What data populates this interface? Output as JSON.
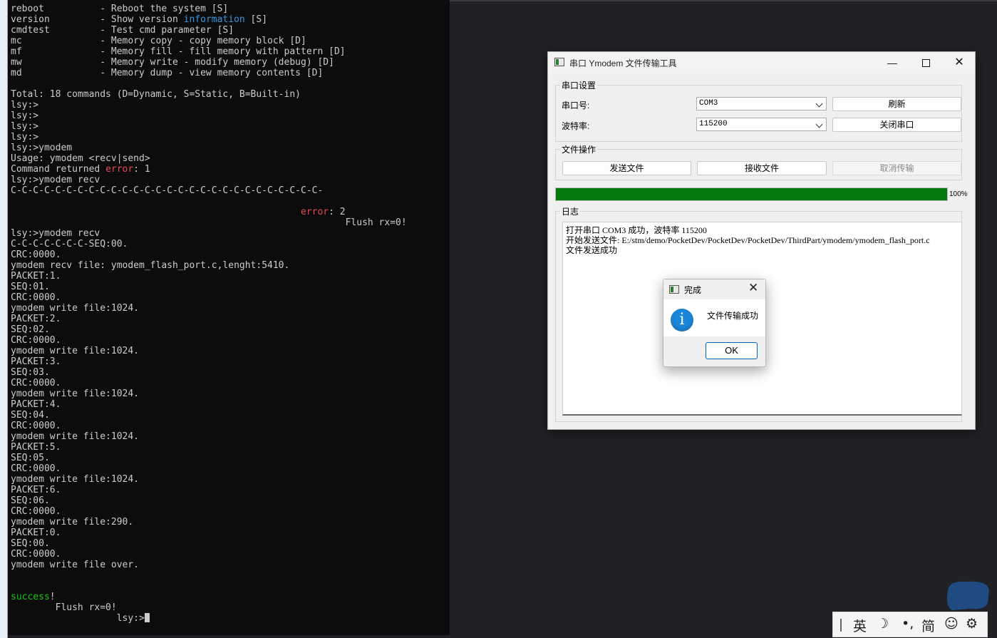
{
  "terminal": {
    "lines": [
      [
        {
          "t": "reboot          - Reboot the system [S]"
        }
      ],
      [
        {
          "t": "version         - Show version "
        },
        {
          "t": "information",
          "c": "t-blue"
        },
        {
          "t": " [S]"
        }
      ],
      [
        {
          "t": "cmdtest         - Test cmd parameter [S]"
        }
      ],
      [
        {
          "t": "mc              - Memory copy - copy memory block [D]"
        }
      ],
      [
        {
          "t": "mf              - Memory fill - fill memory with pattern [D]"
        }
      ],
      [
        {
          "t": "mw              - Memory write - modify memory (debug) [D]"
        }
      ],
      [
        {
          "t": "md              - Memory dump - view memory contents [D]"
        }
      ],
      [
        {
          "t": ""
        }
      ],
      [
        {
          "t": "Total: 18 commands (D=Dynamic, S=Static, B=Built-in)"
        }
      ],
      [
        {
          "t": "lsy:>"
        }
      ],
      [
        {
          "t": "lsy:>"
        }
      ],
      [
        {
          "t": "lsy:>"
        }
      ],
      [
        {
          "t": "lsy:>"
        }
      ],
      [
        {
          "t": "lsy:>ymodem"
        }
      ],
      [
        {
          "t": "Usage: ymodem <recv|send>"
        }
      ],
      [
        {
          "t": "Command returned "
        },
        {
          "t": "error",
          "c": "t-red"
        },
        {
          "t": ": 1"
        }
      ],
      [
        {
          "t": "lsy:>ymodem recv"
        }
      ],
      [
        {
          "t": "C-C-C-C-C-C-C-C-C-C-C-C-C-C-C-C-C-C-C-C-C-C-C-C-C-C-C-C-"
        }
      ],
      [
        {
          "t": ""
        }
      ],
      [
        {
          "t": "                                                    "
        },
        {
          "t": "error",
          "c": "t-red"
        },
        {
          "t": ": 2"
        }
      ],
      [
        {
          "t": "                                                            Flush rx=0!"
        }
      ],
      [
        {
          "t": "lsy:>ymodem recv"
        }
      ],
      [
        {
          "t": "C-C-C-C-C-C-C-SEQ:00."
        }
      ],
      [
        {
          "t": "CRC:0000."
        }
      ],
      [
        {
          "t": "ymodem recv file: ymodem_flash_port.c,lenght:5410."
        }
      ],
      [
        {
          "t": "PACKET:1."
        }
      ],
      [
        {
          "t": "SEQ:01."
        }
      ],
      [
        {
          "t": "CRC:0000."
        }
      ],
      [
        {
          "t": "ymodem write file:1024."
        }
      ],
      [
        {
          "t": "PACKET:2."
        }
      ],
      [
        {
          "t": "SEQ:02."
        }
      ],
      [
        {
          "t": "CRC:0000."
        }
      ],
      [
        {
          "t": "ymodem write file:1024."
        }
      ],
      [
        {
          "t": "PACKET:3."
        }
      ],
      [
        {
          "t": "SEQ:03."
        }
      ],
      [
        {
          "t": "CRC:0000."
        }
      ],
      [
        {
          "t": "ymodem write file:1024."
        }
      ],
      [
        {
          "t": "PACKET:4."
        }
      ],
      [
        {
          "t": "SEQ:04."
        }
      ],
      [
        {
          "t": "CRC:0000."
        }
      ],
      [
        {
          "t": "ymodem write file:1024."
        }
      ],
      [
        {
          "t": "PACKET:5."
        }
      ],
      [
        {
          "t": "SEQ:05."
        }
      ],
      [
        {
          "t": "CRC:0000."
        }
      ],
      [
        {
          "t": "ymodem write file:1024."
        }
      ],
      [
        {
          "t": "PACKET:6."
        }
      ],
      [
        {
          "t": "SEQ:06."
        }
      ],
      [
        {
          "t": "CRC:0000."
        }
      ],
      [
        {
          "t": "ymodem write file:290."
        }
      ],
      [
        {
          "t": "PACKET:0."
        }
      ],
      [
        {
          "t": "SEQ:00."
        }
      ],
      [
        {
          "t": "CRC:0000."
        }
      ],
      [
        {
          "t": "ymodem write file over."
        }
      ],
      [
        {
          "t": ""
        }
      ],
      [
        {
          "t": ""
        }
      ],
      [
        {
          "t": "success",
          "c": "t-green"
        },
        {
          "t": "!"
        }
      ],
      [
        {
          "t": "        Flush rx=0!"
        }
      ],
      [
        {
          "t": "                   lsy:>"
        },
        {
          "cursor": true
        }
      ]
    ]
  },
  "window": {
    "title": "串口 Ymodem 文件传输工具",
    "icon": "app-window-icon",
    "min_glyph": "—",
    "close_glyph": "✕",
    "serial_group": {
      "title": "串口设置",
      "port_label": "串口号:",
      "port_value": "COM3",
      "baud_label": "波特率:",
      "baud_value": "115200",
      "refresh_label": "刷新",
      "close_port_label": "关闭串口"
    },
    "file_group": {
      "title": "文件操作",
      "send_label": "发送文件",
      "recv_label": "接收文件",
      "cancel_label": "取消传输"
    },
    "progress": {
      "value": 100,
      "text": "100%",
      "color": "#06790e"
    },
    "log_group": {
      "title": "日志",
      "lines": [
        "打开串口 COM3 成功，波特率 115200",
        "开始发送文件: E:/stm/demo/PocketDev/PocketDev/PocketDev/ThirdPart/ymodem/ymodem_flash_port.c",
        "文件发送成功"
      ]
    }
  },
  "dialog": {
    "title": "完成",
    "close_glyph": "✕",
    "message": "文件传输成功",
    "icon_glyph": "i",
    "ok_label": "OK"
  },
  "ime": {
    "items": [
      "英",
      "☽",
      "•,",
      "简",
      "☺",
      "⚙"
    ]
  },
  "colors": {
    "terminal_bg": "#0c0c0c",
    "terminal_fg": "#cccccc",
    "error": "#e74856",
    "info": "#3a96dd",
    "success": "#16c60c",
    "info_icon": "#1a86d9"
  }
}
